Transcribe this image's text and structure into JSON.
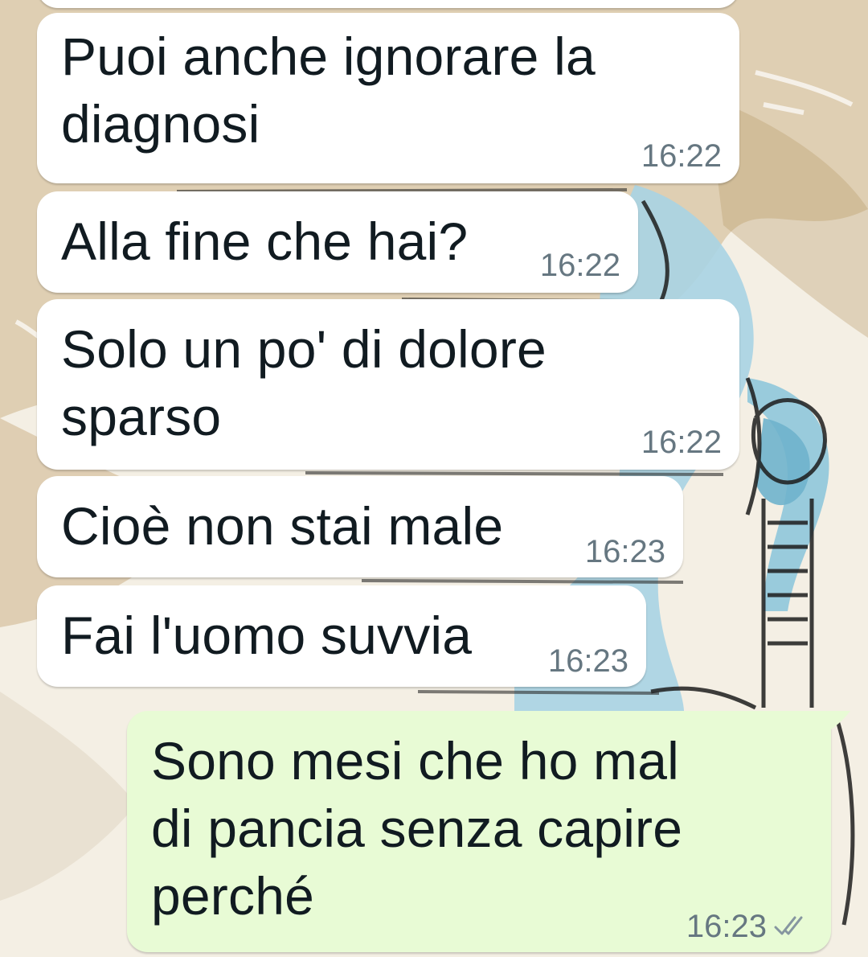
{
  "conversation": {
    "messages": [
      {
        "direction": "incoming",
        "text": "Puoi anche ignorare la\ndiagnosi",
        "time": "16:22"
      },
      {
        "direction": "incoming",
        "text": "Alla fine che hai?",
        "time": "16:22"
      },
      {
        "direction": "incoming",
        "text": "Solo un po' di dolore\nsparso",
        "time": "16:22"
      },
      {
        "direction": "incoming",
        "text": "Cioè non stai male",
        "time": "16:23"
      },
      {
        "direction": "incoming",
        "text": "Fai l'uomo suvvia",
        "time": "16:23"
      },
      {
        "direction": "outgoing",
        "text": "Sono mesi che ho mal\ndi pancia senza capire\nperché",
        "time": "16:23",
        "status": "read"
      }
    ]
  },
  "colors": {
    "incoming_bubble": "#ffffff",
    "outgoing_bubble": "#e8fbd5",
    "text": "#111b21",
    "timestamp": "#667781",
    "read_ticks": "#8696a0"
  },
  "icons": {
    "status": "double-check-icon"
  }
}
